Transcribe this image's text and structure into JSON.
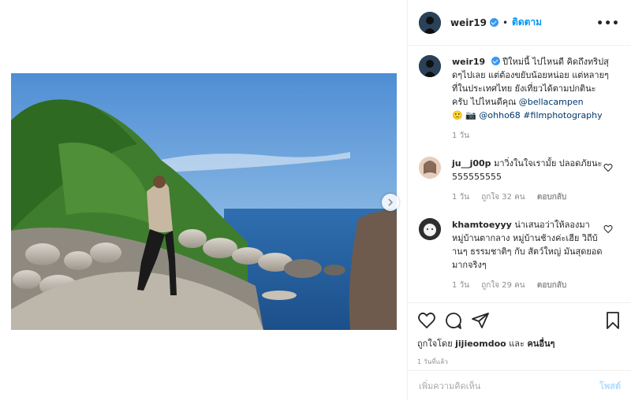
{
  "header": {
    "username": "weir19",
    "separator": "•",
    "follow_label": "ติดตาม",
    "more_icon": "more-horizontal-icon",
    "more_glyph": "•••"
  },
  "caption": {
    "username": "weir19",
    "text": "ปีใหม่นี้ ไปไหนดี คิดถึงทริปสุดๆไปเลย แต่ต้องขยับน้อยหน่อย แต่หลายๆที่ในประเทศไทย ยังเที่ยวได้ตามปกตินะครับ ไปไหนดีคุณ ",
    "mention1": "@bellacampen",
    "emoji": "🙂 📷",
    "mention2": "@ohho68",
    "hashtag": "#filmphotography",
    "time": "1 วัน"
  },
  "comments": [
    {
      "username": "ju__j00p",
      "text": "มาวิ่งในใจเรามั้ย ปลอดภัยนะ 555555555",
      "time": "1 วัน",
      "likes": "ถูกใจ 32 คน",
      "reply": "ตอบกลับ"
    },
    {
      "username": "khamtoeyyy",
      "text": "น่าเสนอว่าให้ลองมาหมู่บ้านตากลาง หมู่บ้านช้างค่ะเฮีย วิถีบ้านๆ ธรรมชาติๆ กับ สัตว์ใหญ่ มันสุดยอดมากจริงๆ",
      "time": "1 วัน",
      "likes": "ถูกใจ 29 คน",
      "reply": "ตอบกลับ"
    }
  ],
  "actions": {
    "liked_by_prefix": "ถูกใจโดย",
    "liked_by_user": "jijieomdoo",
    "liked_by_and": "และ",
    "liked_by_others": "คนอื่นๆ",
    "timestamp": "1 วันที่แล้ว"
  },
  "add_comment": {
    "placeholder": "เพิ่มความคิดเห็น",
    "post_label": "โพสต์"
  },
  "colors": {
    "accent": "#0095f6",
    "verified": "#3897f0",
    "link": "#00376b",
    "muted": "#8e8e8e"
  }
}
